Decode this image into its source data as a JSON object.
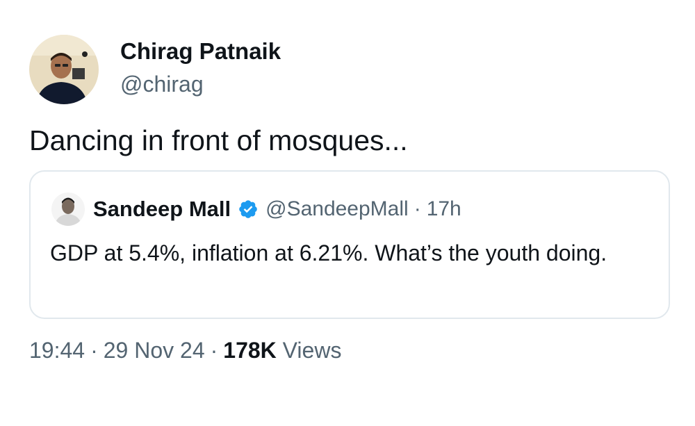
{
  "tweet": {
    "author": {
      "name": "Chirag Patnaik",
      "handle": "@chirag"
    },
    "text": "Dancing in front of mosques...",
    "quoted": {
      "author": {
        "name": "Sandeep Mall",
        "verified": true,
        "handle": "@SandeepMall"
      },
      "separator": "·",
      "time": "17h",
      "text": "GDP at 5.4%, inflation at 6.21%. What’s the youth doing."
    },
    "meta": {
      "time": "19:44",
      "separator": "·",
      "date": "29 Nov 24",
      "views_count": "178K",
      "views_label": "Views"
    }
  },
  "colors": {
    "text_primary": "#0f1419",
    "text_secondary": "#536471",
    "verified_badge": "#1d9bf0",
    "card_border": "#e1e8ed"
  },
  "icons": {
    "verified": "verified-badge-icon"
  }
}
